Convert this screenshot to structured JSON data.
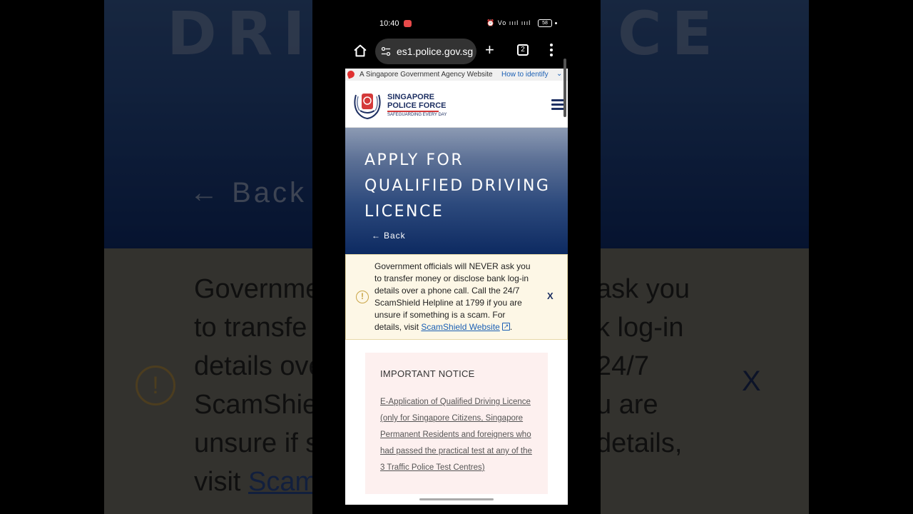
{
  "background": {
    "title_fragment": "DRIVI",
    "title_fragment_right": "CE",
    "back_label": "Back",
    "text_lines": [
      "Governme",
      "to transfe",
      "details ove",
      "ScamShiel",
      "unsure if s",
      "visit"
    ],
    "text_lines_right": [
      "ask you",
      "k log-in",
      "24/7",
      "u are",
      "details,"
    ],
    "link_fragment": "Scam",
    "close_glyph": "X"
  },
  "status_bar": {
    "time": "10:40",
    "signal_text": "⏰ Vo ıııl ıııl",
    "battery": "58"
  },
  "browser": {
    "url": "es1.police.gov.sg",
    "tab_count": "2",
    "new_tab_glyph": "+"
  },
  "gov_banner": {
    "agency_text": "A Singapore Government Agency Website",
    "identify_link": "How to identify",
    "chevron": "⌄"
  },
  "brand": {
    "line1": "SINGAPORE",
    "line2": "POLICE FORCE",
    "tagline": "SAFEGUARDING EVERY DAY"
  },
  "hero": {
    "title": "APPLY FOR QUALIFIED DRIVING LICENCE",
    "back_arrow": "←",
    "back_label": "Back"
  },
  "alert": {
    "icon_glyph": "!",
    "message": "Government officials will NEVER ask you to transfer money or disclose bank log-in details over a phone call. Call the 24/7 ScamShield Helpline at 1799 if you are unsure if something is a scam. For details, visit ",
    "link_text": "ScamShield Website",
    "trailing": ".",
    "close_label": "X"
  },
  "notice": {
    "title": "IMPORTANT NOTICE",
    "link_text": "E-Application of Qualified Driving Licence (only for Singapore Citizens, Singapore Permanent Residents and foreigners who had passed the practical test at any of the 3 Traffic Police Test Centres)"
  },
  "colors": {
    "navy": "#1d2f62",
    "alert_bg": "#fdf7e6",
    "notice_bg": "#fdf0ef",
    "link": "#1a5fb4",
    "brand_red": "#d43a3a"
  }
}
